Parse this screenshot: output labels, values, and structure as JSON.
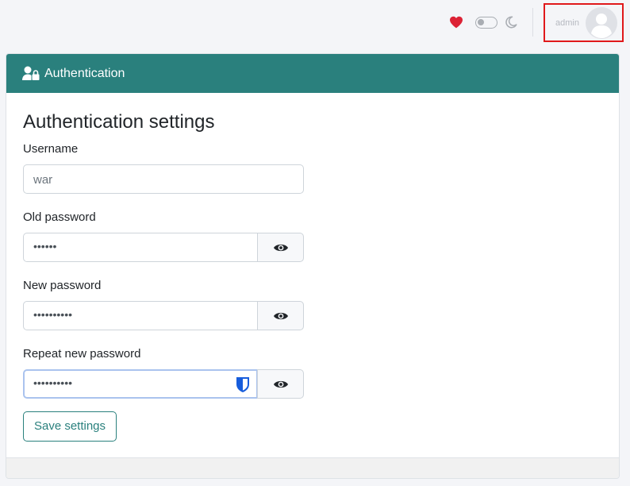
{
  "topbar": {
    "heart_icon": "heart-icon",
    "theme_toggle": "theme-toggle",
    "moon_icon": "moon-icon",
    "user_name": "admin",
    "avatar_icon": "user-avatar-icon"
  },
  "card": {
    "header_title": "Authentication",
    "header_icon": "user-lock-icon",
    "section_title": "Authentication settings"
  },
  "form": {
    "username_label": "Username",
    "username_value": "war",
    "old_password_label": "Old password",
    "old_password_value": "••••••",
    "new_password_label": "New password",
    "new_password_value": "••••••••••",
    "repeat_password_label": "Repeat new password",
    "repeat_password_value": "••••••••••",
    "save_label": "Save settings"
  },
  "colors": {
    "accent": "#2a807d",
    "heart": "#dc2235",
    "highlight_box": "#e0191b",
    "focus_border": "#aac3ee",
    "shield": "#175ddc"
  }
}
